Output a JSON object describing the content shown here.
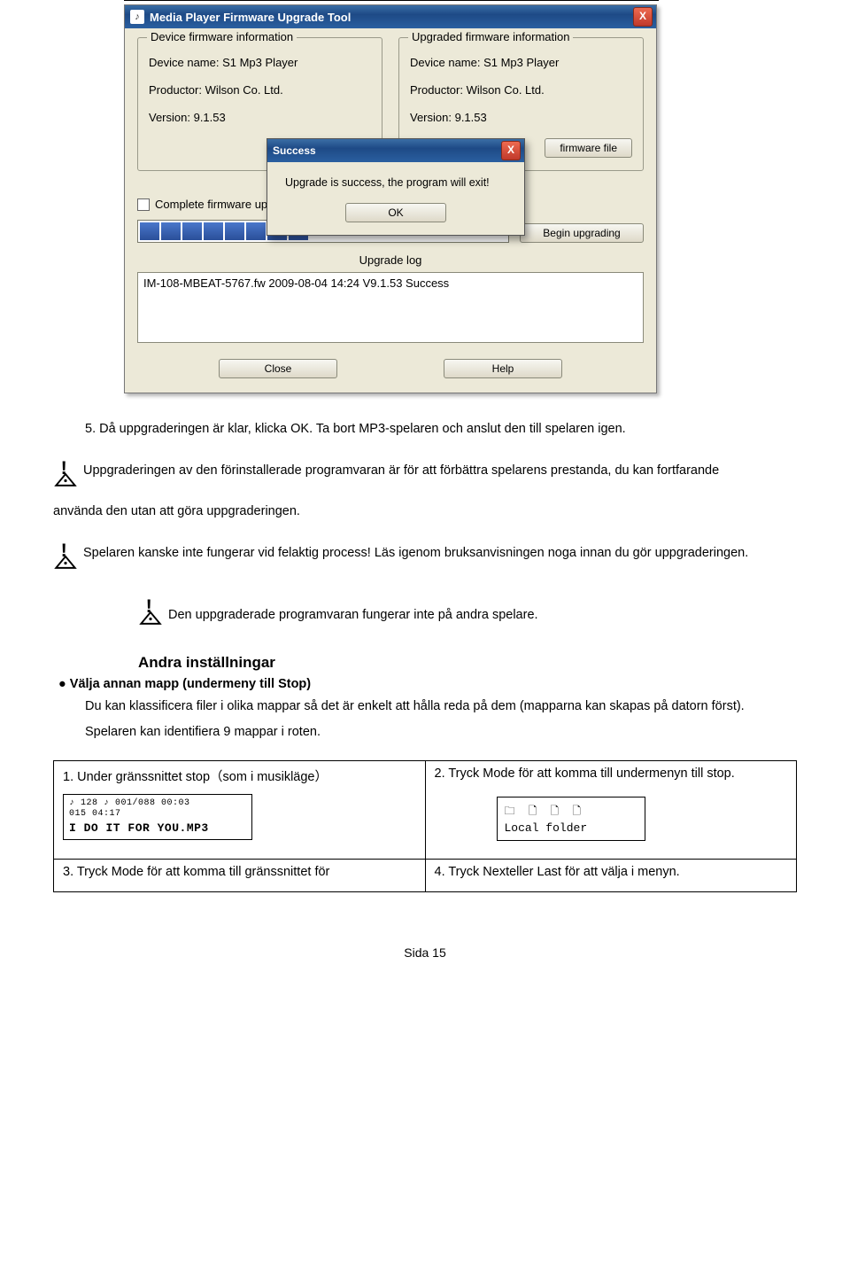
{
  "dialog": {
    "title": "Media Player Firmware Upgrade Tool",
    "left": {
      "legend": "Device firmware information",
      "device_label": "Device name: S1 Mp3 Player",
      "productor": "Productor: Wilson Co. Ltd.",
      "version": "Version: 9.1.53"
    },
    "right": {
      "legend": "Upgraded firmware information",
      "device_label": "Device name: S1 Mp3 Player",
      "productor": "Productor: Wilson Co. Ltd.",
      "version": "Version: 9.1.53",
      "select_btn": "firmware file"
    },
    "checkbox_label": "Complete firmware upg",
    "begin_btn": "Begin upgrading",
    "upgrade_log_label": "Upgrade log",
    "log_line": "IM-108-MBEAT-5767.fw 2009-08-04 14:24 V9.1.53 Success",
    "close_btn": "Close",
    "help_btn": "Help"
  },
  "overlay": {
    "title": "Success",
    "message": "Upgrade is success, the program will exit!",
    "ok": "OK"
  },
  "text": {
    "step5": "5. Då uppgraderingen är klar, klicka OK. Ta bort MP3-spelaren och anslut den till spelaren igen.",
    "warn1a": "Uppgraderingen av den förinstallerade programvaran är för att förbättra spelarens prestanda, du kan fortfarande",
    "warn1b": "använda den utan att göra uppgraderingen.",
    "warn2": "Spelaren kanske inte fungerar vid felaktig process! Läs igenom bruksanvisningen noga innan du gör uppgraderingen.",
    "warn3": "Den uppgraderade programvaran fungerar inte på andra spelare.",
    "heading": "Andra inställningar",
    "bullet": "Välja annan mapp (undermeny till Stop)",
    "body1": "Du kan klassificera filer i olika mappar så det är enkelt att hålla reda på dem (mapparna kan skapas på datorn först).",
    "body2": "Spelaren kan identifiera 9 mappar i roten."
  },
  "steps": {
    "s1": "1. Under gränssnittet stop（som i musikläge）",
    "s2": "2. Tryck Mode för att komma till undermenyn till stop.",
    "s3": "3. Tryck Mode för att komma till gränssnittet för",
    "s4": "4. Tryck Nexteller Last för att välja i menyn.",
    "lcd1_line1": "♪ 128  ♪ 001/088 00:03",
    "lcd1_line1b": "   015        04:17",
    "lcd1_line2": "I DO IT FOR YOU.MP3",
    "lcd2_icons": "🗀 🗋 🗋 🗋",
    "lcd2_text": "Local folder"
  },
  "page": "Sida 15"
}
